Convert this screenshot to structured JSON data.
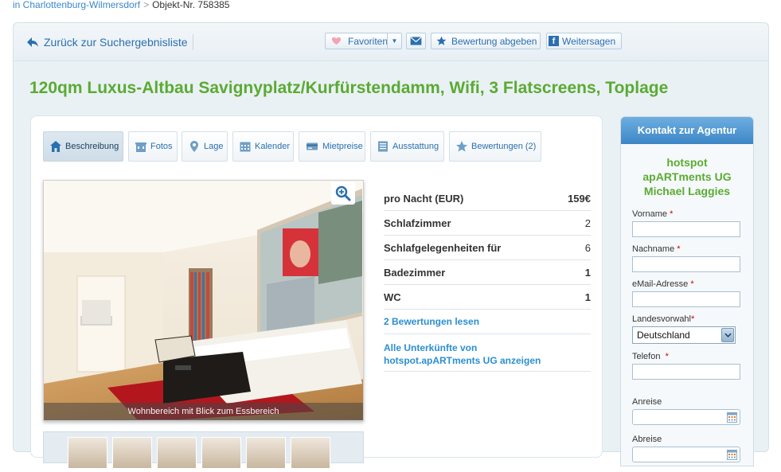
{
  "breadcrumb": {
    "location_link": "in Charlottenburg-Wilmersdorf",
    "separator": ">",
    "object_number": "Objekt-Nr. 758385"
  },
  "toolbar": {
    "back_label": "Zurück zur Suchergebnisliste",
    "favorites_label": "Favoriten",
    "rate_label": "Bewertung abgeben",
    "share_label": "Weitersagen",
    "share_icon_letter": "f"
  },
  "listing": {
    "title": "120qm Luxus-Altbau Savignyplatz/Kurfürstendamm, Wifi, 3 Flatscreens, Toplage"
  },
  "tabs": [
    {
      "label": "Beschreibung",
      "icon": "house-icon",
      "active": true
    },
    {
      "label": "Fotos",
      "icon": "building-icon",
      "active": false
    },
    {
      "label": "Lage",
      "icon": "map-pin-icon",
      "active": false
    },
    {
      "label": "Kalender",
      "icon": "calendar-icon",
      "active": false
    },
    {
      "label": "Mietpreise",
      "icon": "credit-card-icon",
      "active": false
    },
    {
      "label": "Ausstattung",
      "icon": "list-icon",
      "active": false
    },
    {
      "label": "Bewertungen (2)",
      "icon": "star-icon",
      "active": false
    }
  ],
  "photo": {
    "caption": "Wohnbereich mit Blick zum Essbereich"
  },
  "facts": [
    {
      "label": "pro Nacht (EUR)",
      "value": "159€"
    },
    {
      "label": "Schlafzimmer",
      "value": "2"
    },
    {
      "label": "Schlafgelegenheiten für",
      "value": "6"
    },
    {
      "label": "Badezimmer",
      "value": "1"
    },
    {
      "label": "WC",
      "value": "1"
    }
  ],
  "links": {
    "reviews": "2  Bewertungen lesen",
    "all_listings_line1": "Alle Unterkünfte von",
    "all_listings_line2": "hotspot.apARTments UG anzeigen"
  },
  "contact": {
    "header": "Kontakt zur Agentur",
    "agency_line1": "hotspot",
    "agency_line2": "apARTments UG",
    "agency_line3": "Michael Laggies",
    "required_mark": "*",
    "fields": {
      "vorname": "Vorname",
      "nachname": "Nachname",
      "email": "eMail-Adresse",
      "land": "Landesvorwahl",
      "land_value": "Deutschland",
      "telefon": "Telefon",
      "anreise": "Anreise",
      "abreise": "Abreise"
    }
  },
  "colors": {
    "title_green": "#5aab32",
    "link_blue": "#2b8fd0",
    "header_blue": "#3d86c6",
    "required_red": "#cc0000"
  }
}
